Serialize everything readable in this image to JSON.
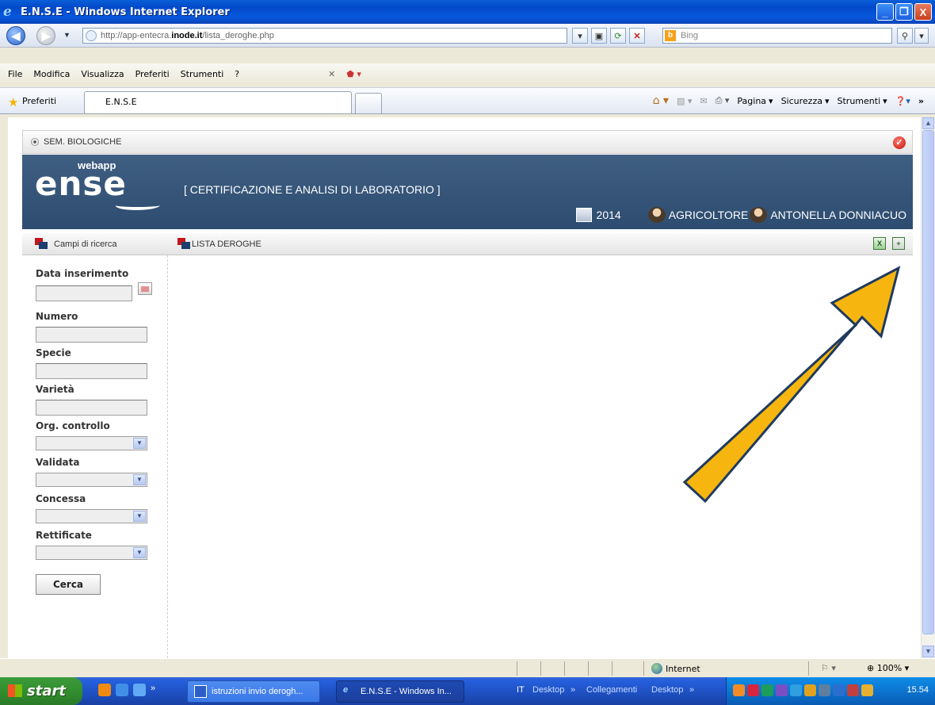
{
  "window": {
    "title": "E.N.S.E - Windows Internet Explorer",
    "min_btn": "_",
    "max_btn": "❐",
    "close_btn": "X"
  },
  "address": {
    "url_prefix": "http://app-entecra.",
    "url_domain": "inode.it",
    "url_path": "/lista_deroghe.php",
    "search_placeholder": "Bing"
  },
  "menu": {
    "items": [
      "File",
      "Modifica",
      "Visualizza",
      "Preferiti",
      "Strumenti",
      "?"
    ]
  },
  "favorites": {
    "label": "Preferiti",
    "tab_title": "E.N.S.E",
    "commands": [
      "Pagina",
      "Sicurezza",
      "Strumenti"
    ]
  },
  "app": {
    "module": "SEM. BIOLOGICHE",
    "logo_small": "webapp",
    "logo_big": "ense",
    "tagline": "[ CERTIFICAZIONE E ANALISI DI LABORATORIO ]",
    "year": "2014",
    "role": "AGRICOLTORE",
    "user": "ANTONELLA DONNIACUO"
  },
  "toolbar": {
    "search_fields_label": "Campi di ricerca",
    "list_label": "LISTA DEROGHE"
  },
  "form": {
    "data_inserimento": "Data inserimento",
    "numero": "Numero",
    "specie": "Specie",
    "varieta": "Varietà",
    "org_controllo": "Org. controllo",
    "validata": "Validata",
    "concessa": "Concessa",
    "rettificate": "Rettificate",
    "submit": "Cerca"
  },
  "status": {
    "zone": "Internet",
    "zoom": "100%"
  },
  "taskbar": {
    "start": "start",
    "task1": "istruzioni invio derogh...",
    "task2": "E.N.S.E - Windows In...",
    "lang": "IT",
    "toolbar1": "Desktop",
    "toolbar2": "Collegamenti",
    "toolbar3": "Desktop",
    "clock": "15.54"
  },
  "colors": {
    "banner": "#2d4c70",
    "arrow_fill": "#f6b60f",
    "arrow_stroke": "#1f3a5f"
  }
}
